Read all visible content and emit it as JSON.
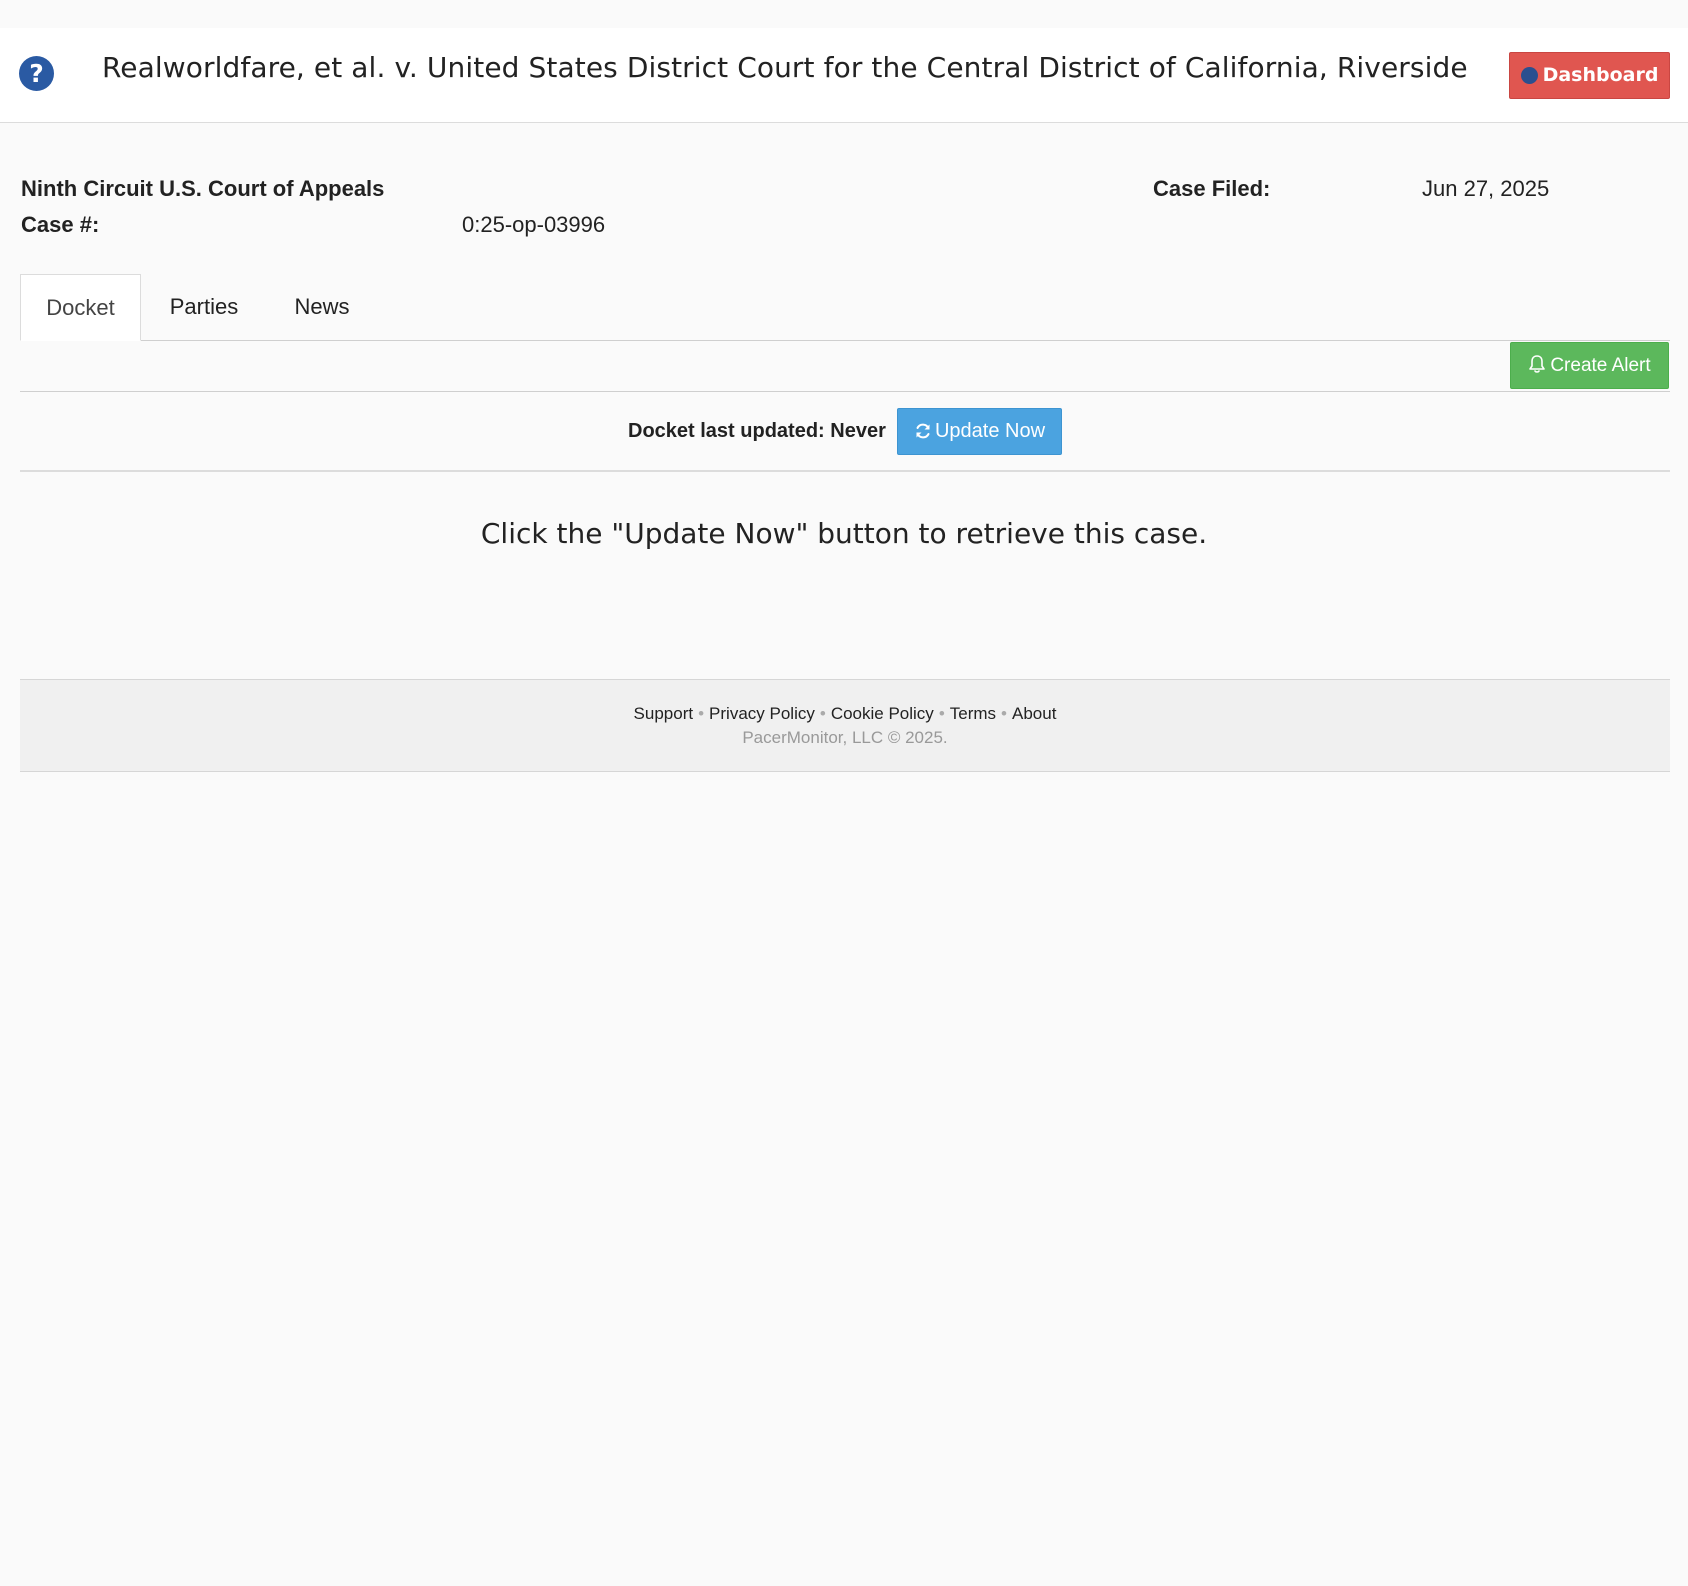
{
  "header": {
    "title": "Realworldfare, et al. v. United States District Court for the Central District of California, Riverside",
    "dashboard_label": "Dashboard"
  },
  "case_info": {
    "court": "Ninth Circuit U.S. Court of Appeals",
    "case_num_label": "Case #:",
    "case_num_value": "0:25-op-03996",
    "filed_label": "Case Filed:",
    "filed_value": "Jun 27, 2025"
  },
  "tabs": [
    {
      "label": "Docket",
      "active": true
    },
    {
      "label": "Parties",
      "active": false
    },
    {
      "label": "News",
      "active": false
    }
  ],
  "toolbar": {
    "create_alert_label": "Create Alert"
  },
  "docket": {
    "last_updated": "Docket last updated: Never",
    "update_label": "Update Now",
    "message": "Click the \"Update Now\" button to retrieve this case."
  },
  "footer": {
    "links": [
      "Support",
      "Privacy Policy",
      "Cookie Policy",
      "Terms",
      "About"
    ],
    "copyright": "PacerMonitor, LLC © 2025."
  },
  "icons": {
    "help": "question-circle-icon",
    "dashboard": "circle-icon",
    "alert": "bell-icon",
    "update": "refresh-icon"
  },
  "colors": {
    "dashboard_button": "#e05650",
    "create_alert_button": "#5cb85c",
    "update_button": "#4ba3e0",
    "help_icon": "#2a5aa3"
  }
}
